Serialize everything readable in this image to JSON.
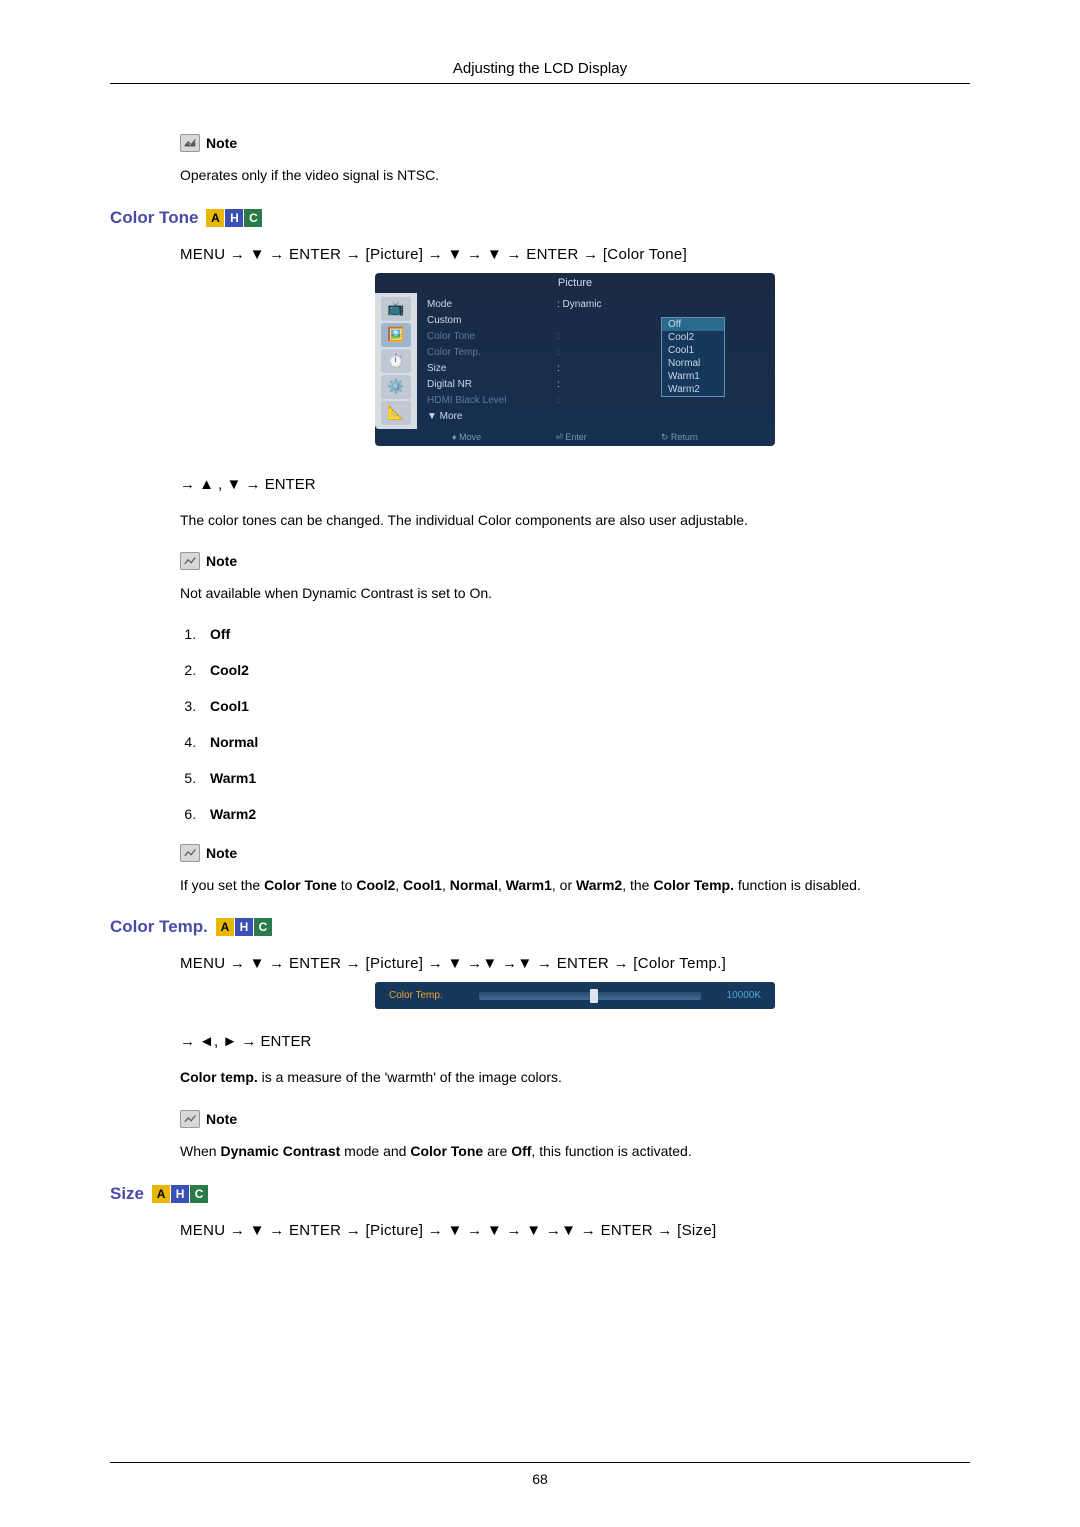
{
  "header": {
    "title": "Adjusting the LCD Display"
  },
  "note_label": "Note",
  "sec1": {
    "note_text": "Operates only if the video signal is NTSC."
  },
  "color_tone": {
    "heading": "Color Tone",
    "nav": "MENU → ▼ → ENTER → [Picture] → ▼ → ▼ → ENTER → [Color Tone]",
    "nav2": "→ ▲ , ▼ → ENTER",
    "desc": "The color tones can be changed. The individual Color components are also user adjustable.",
    "note1": "Not available when Dynamic Contrast is set to On.",
    "options": [
      "Off",
      "Cool2",
      "Cool1",
      "Normal",
      "Warm1",
      "Warm2"
    ],
    "note2_pre": "If you set the ",
    "note2_b1": "Color Tone",
    "note2_mid1": " to ",
    "note2_b2": "Cool2",
    "note2_c": ", ",
    "note2_b3": "Cool1",
    "note2_b4": "Normal",
    "note2_b5": "Warm1",
    "note2_or": ", or ",
    "note2_b6": "Warm2",
    "note2_mid2": ", the ",
    "note2_b7": "Color Temp.",
    "note2_end": " function is disabled."
  },
  "osd": {
    "title": "Picture",
    "rows": [
      {
        "label": "Mode",
        "val": ": Dynamic",
        "dim": false
      },
      {
        "label": "Custom",
        "val": "",
        "dim": false
      },
      {
        "label": "Color Tone",
        "val": ":",
        "dim": true
      },
      {
        "label": "Color Temp.",
        "val": ":",
        "dim": true
      },
      {
        "label": "Size",
        "val": ":",
        "dim": false
      },
      {
        "label": "Digital NR",
        "val": ":",
        "dim": false
      },
      {
        "label": "HDMI Black Level",
        "val": ":",
        "dim": true
      },
      {
        "label": "▼  More",
        "val": "",
        "dim": false
      }
    ],
    "popup": [
      "Off",
      "Cool2",
      "Cool1",
      "Normal",
      "Warm1",
      "Warm2"
    ],
    "footer": [
      "♦ Move",
      "⏎ Enter",
      "↻ Return"
    ]
  },
  "color_temp": {
    "heading": "Color Temp.",
    "nav": "MENU → ▼ → ENTER → [Picture] → ▼ →▼ →▼ → ENTER → [Color Temp.]",
    "slider_label": "Color Temp.",
    "slider_value": "10000K",
    "nav2": "→ ◄, ► → ENTER",
    "desc_b": "Color temp.",
    "desc_rest": " is a measure of the 'warmth' of the image colors.",
    "note_pre": "When ",
    "note_b1": "Dynamic Contrast",
    "note_mid": " mode and ",
    "note_b2": "Color Tone",
    "note_mid2": " are ",
    "note_b3": "Off",
    "note_end": ", this function is activated."
  },
  "size": {
    "heading": "Size",
    "nav": "MENU → ▼ → ENTER → [Picture] → ▼ → ▼ → ▼ →▼ → ENTER → [Size]"
  },
  "page_number": "68",
  "badges": {
    "a": "A",
    "h": "H",
    "c": "C"
  }
}
